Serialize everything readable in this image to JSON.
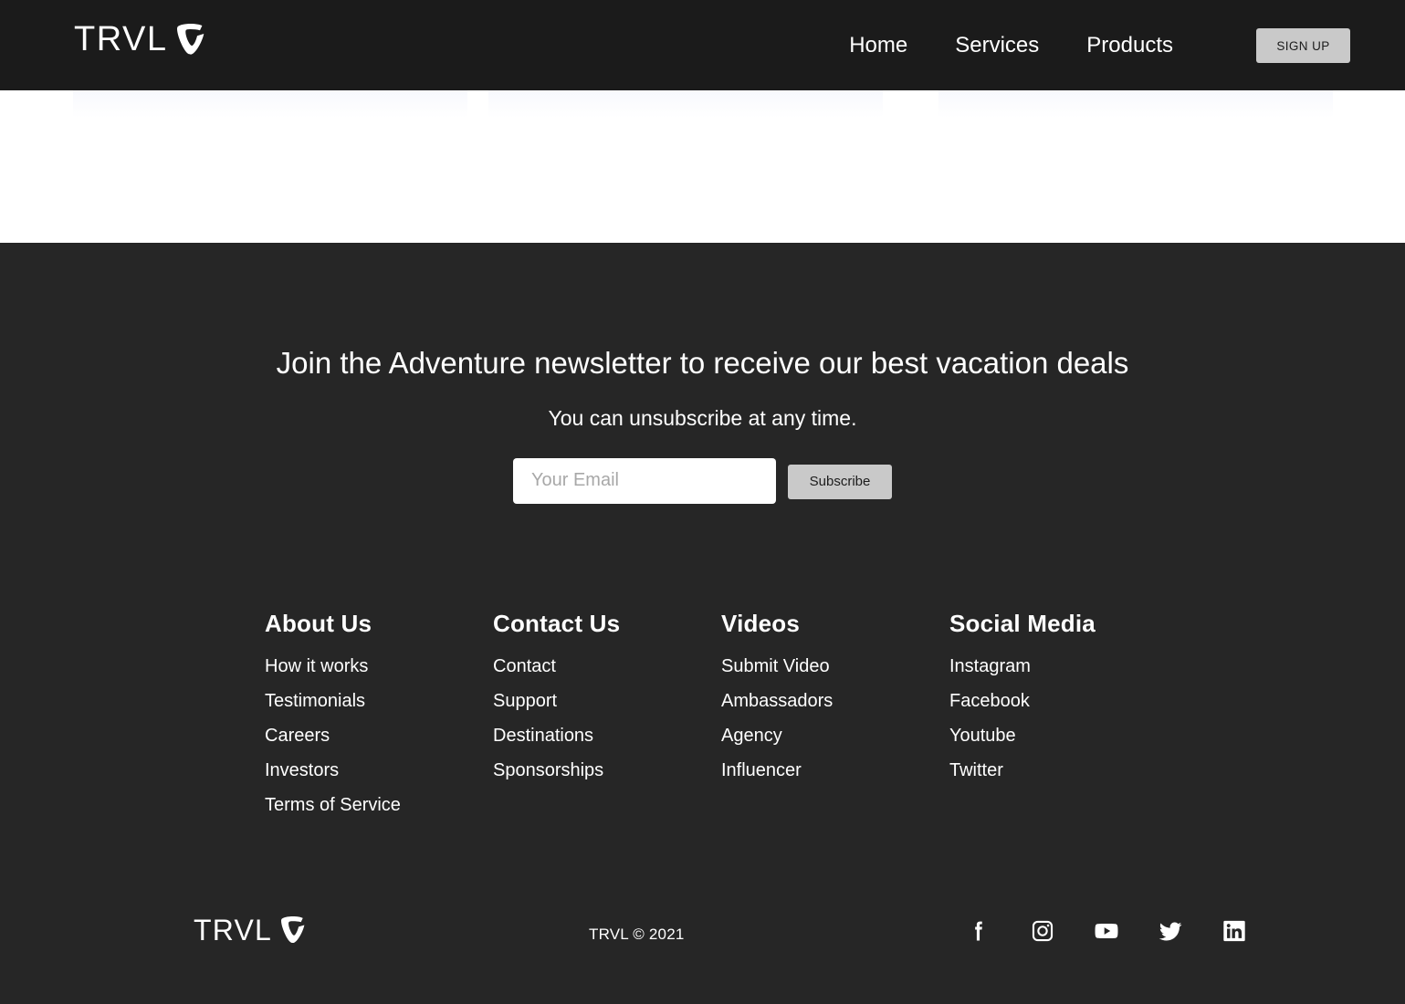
{
  "brand": {
    "word": "TRVL",
    "mark_icon": "typo3-shield-icon"
  },
  "header": {
    "nav": [
      {
        "label": "Home"
      },
      {
        "label": "Services"
      },
      {
        "label": "Products"
      }
    ],
    "signup_label": "SIGN UP"
  },
  "footer": {
    "newsletter": {
      "title": "Join the Adventure newsletter to receive our best vacation deals",
      "subtitle": "You can unsubscribe at any time.",
      "email_placeholder": "Your Email",
      "email_value": "",
      "subscribe_label": "Subscribe"
    },
    "columns": [
      {
        "title": "About Us",
        "links": [
          {
            "label": "How it works"
          },
          {
            "label": "Testimonials"
          },
          {
            "label": "Careers"
          },
          {
            "label": "Investors"
          },
          {
            "label": "Terms of Service"
          }
        ]
      },
      {
        "title": "Contact Us",
        "links": [
          {
            "label": "Contact"
          },
          {
            "label": "Support"
          },
          {
            "label": "Destinations"
          },
          {
            "label": "Sponsorships"
          }
        ]
      },
      {
        "title": "Videos",
        "links": [
          {
            "label": "Submit Video"
          },
          {
            "label": "Ambassadors"
          },
          {
            "label": "Agency"
          },
          {
            "label": "Influencer"
          }
        ]
      },
      {
        "title": "Social Media",
        "links": [
          {
            "label": "Instagram"
          },
          {
            "label": "Facebook"
          },
          {
            "label": "Youtube"
          },
          {
            "label": "Twitter"
          }
        ]
      }
    ],
    "copyright": "TRVL © 2021",
    "social_icons": [
      {
        "name": "facebook-icon"
      },
      {
        "name": "instagram-icon"
      },
      {
        "name": "youtube-icon"
      },
      {
        "name": "twitter-icon"
      },
      {
        "name": "linkedin-icon"
      }
    ]
  },
  "colors": {
    "header_bg": "#1b1b1b",
    "footer_bg": "#262626",
    "content_bg": "#ffffff",
    "button_bg": "#c9c9c9",
    "button_text": "#1c1c1c",
    "text": "#ffffff",
    "placeholder": "#a8a8a8",
    "ghost_card": "#eef1fb"
  }
}
